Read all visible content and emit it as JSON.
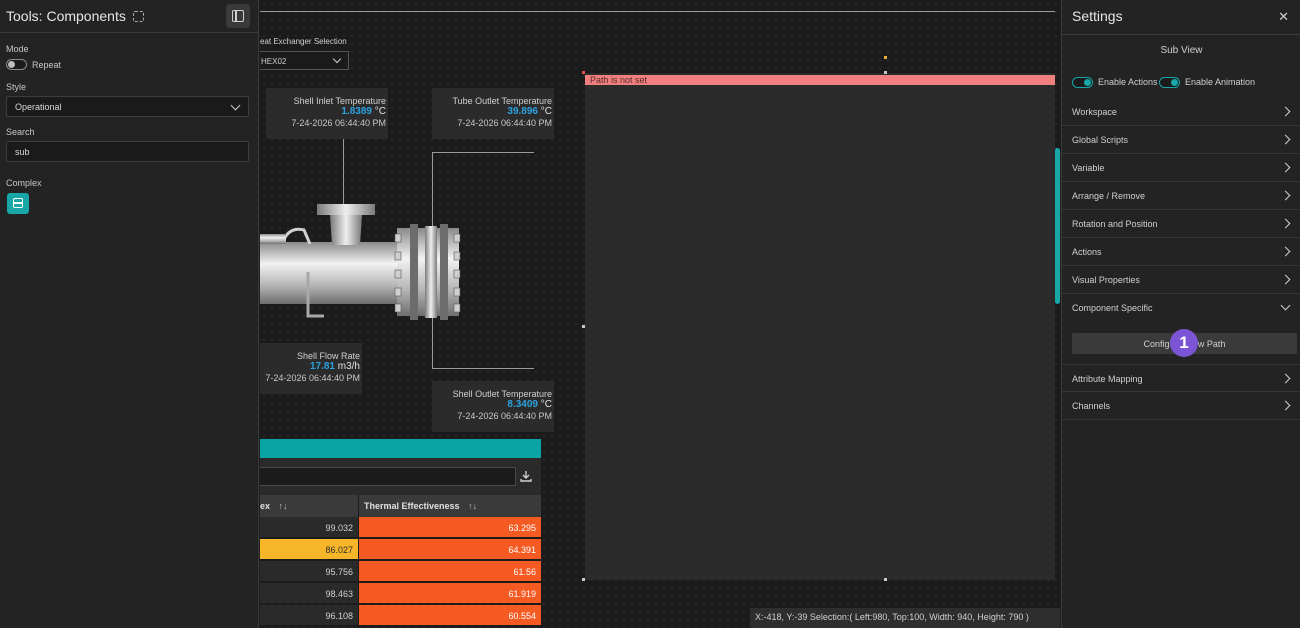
{
  "left_panel": {
    "title": "Tools: Components",
    "mode_label": "Mode",
    "mode_toggle_label": "Repeat",
    "style_label": "Style",
    "style_value": "Operational",
    "search_label": "Search",
    "search_value": "sub",
    "complex_label": "Complex"
  },
  "canvas": {
    "hex_selection_label": "eat Exchanger Selection",
    "hex_selection_value": "HEX02",
    "cards": {
      "shell_inlet": {
        "title": "Shell Inlet Temperature",
        "value": "1.8389",
        "unit": "°C",
        "date": "7-24-2026 06:44:40 PM"
      },
      "tube_outlet": {
        "title": "Tube Outlet Temperature",
        "value": "39.896",
        "unit": "°C",
        "date": "7-24-2026 06:44:40 PM"
      },
      "shell_flow": {
        "title": "Shell Flow Rate",
        "value": "17.81",
        "unit": "m3/h",
        "date": "7-24-2026 06:44:40 PM"
      },
      "shell_outlet": {
        "title": "Shell Outlet Temperature",
        "value": "8.3409",
        "unit": "°C",
        "date": "7-24-2026 06:44:40 PM"
      }
    },
    "table": {
      "col1_header": "ex",
      "col2_header": "Thermal Effectiveness",
      "rows": [
        {
          "c1": "99.032",
          "c2": "63.295"
        },
        {
          "c1": "86.027",
          "c2": "64.391"
        },
        {
          "c1": "95.756",
          "c2": "61.56"
        },
        {
          "c1": "98.463",
          "c2": "61.919"
        },
        {
          "c1": "96.108",
          "c2": "60.554"
        }
      ]
    },
    "path_banner": "Path is not set",
    "status": "X:-418, Y:-39  Selection:( Left:980, Top:100, Width: 940, Height: 790 )"
  },
  "right_panel": {
    "title": "Settings",
    "subview_label": "Sub View",
    "enable_actions": "Enable Actions",
    "enable_animation": "Enable Animation",
    "sections": {
      "workspace": "Workspace",
      "global_scripts": "Global Scripts",
      "variable": "Variable",
      "arrange_remove": "Arrange / Remove",
      "rotation_position": "Rotation and Position",
      "actions": "Actions",
      "visual_properties": "Visual Properties",
      "component_specific": "Component Specific",
      "attribute_mapping": "Attribute Mapping",
      "channels": "Channels"
    },
    "config_button": "Configure View Path",
    "badge": "1"
  },
  "colors": {
    "accent_teal": "#18a6a6",
    "value_blue": "#2aa2e0",
    "orange_cell": "#f45a22",
    "yellow_cell": "#f7b62a",
    "banner_pink": "#f08080",
    "badge_purple": "#7b55d6"
  }
}
